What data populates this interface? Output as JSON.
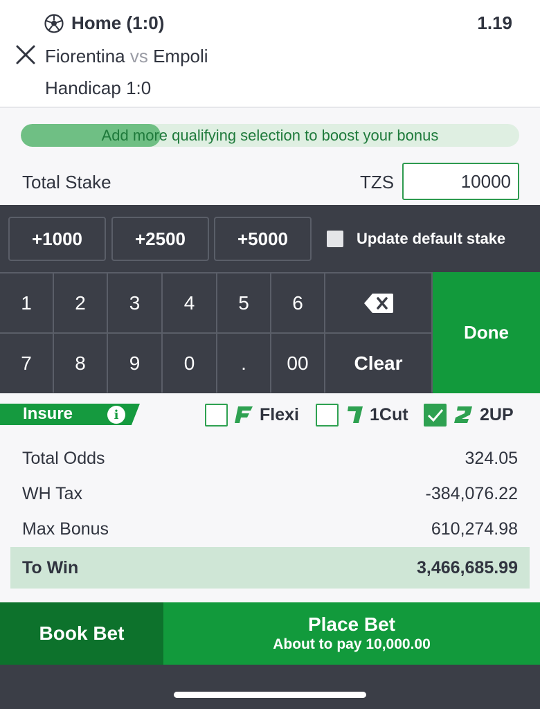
{
  "selection": {
    "market": "Home (1:0)",
    "odds": "1.19",
    "home_team": "Fiorentina",
    "vs": "vs",
    "away_team": "Empoli",
    "handicap": "Handicap 1:0",
    "icon": "soccer-ball-icon",
    "close_icon": "close-icon"
  },
  "bonus": {
    "message": "Add more qualifying selection to boost your bonus",
    "progress_fraction": 0.28
  },
  "stake": {
    "label": "Total Stake",
    "currency": "TZS",
    "value": "10000"
  },
  "quick_stakes": [
    "+1000",
    "+2500",
    "+5000"
  ],
  "update_default": {
    "label": "Update default stake",
    "checked": false
  },
  "keypad": {
    "row1": [
      "1",
      "2",
      "3",
      "4",
      "5",
      "6"
    ],
    "row2": [
      "7",
      "8",
      "9",
      "0",
      ".",
      "00"
    ],
    "backspace_icon": "backspace-icon",
    "clear": "Clear",
    "done": "Done"
  },
  "insure": {
    "label": "Insure",
    "info_icon": "info-icon",
    "options": [
      {
        "label": "Flexi",
        "badge": "F",
        "checked": false
      },
      {
        "label": "1Cut",
        "badge": "1",
        "checked": false
      },
      {
        "label": "2UP",
        "badge": "2",
        "checked": true
      }
    ]
  },
  "summary": {
    "total_odds_label": "Total Odds",
    "total_odds": "324.05",
    "wh_tax_label": "WH Tax",
    "wh_tax": "-384,076.22",
    "max_bonus_label": "Max Bonus",
    "max_bonus": "610,274.98",
    "to_win_label": "To Win",
    "to_win": "3,466,685.99"
  },
  "actions": {
    "book_bet": "Book Bet",
    "place_bet": "Place Bet",
    "place_bet_sub": "About to pay 10,000.00"
  },
  "colors": {
    "brand_green": "#129a3c",
    "dark_green": "#0d722c",
    "keypad_bg": "#3b3e47",
    "text": "#30343f"
  }
}
